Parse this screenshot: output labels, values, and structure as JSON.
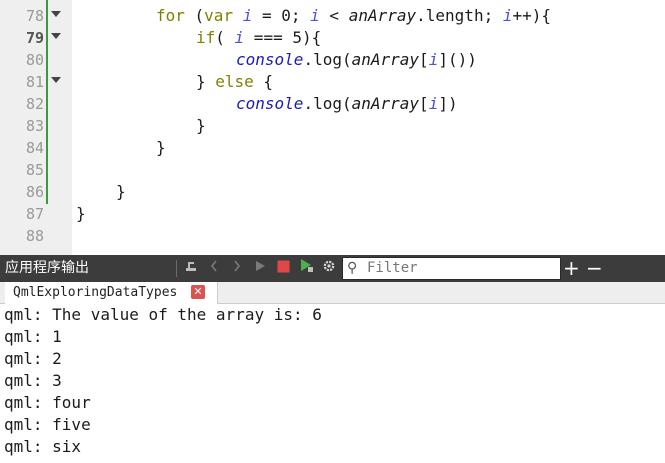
{
  "editor": {
    "gutter": [
      {
        "num": "78",
        "fold": true,
        "current": false
      },
      {
        "num": "79",
        "fold": true,
        "current": true
      },
      {
        "num": "80",
        "fold": false,
        "current": false
      },
      {
        "num": "81",
        "fold": true,
        "current": false
      },
      {
        "num": "82",
        "fold": false,
        "current": false
      },
      {
        "num": "83",
        "fold": false,
        "current": false
      },
      {
        "num": "84",
        "fold": false,
        "current": false
      },
      {
        "num": "85",
        "fold": false,
        "current": false
      },
      {
        "num": "86",
        "fold": false,
        "current": false
      },
      {
        "num": "87",
        "fold": false,
        "current": false
      },
      {
        "num": "88",
        "fold": false,
        "current": false
      }
    ],
    "code": {
      "l78": {
        "for": "for",
        "open": " (",
        "var": "var",
        "sp1": " ",
        "i1": "i",
        "eq": " = 0; ",
        "i2": "i",
        "lt": " < ",
        "arr": "anArray",
        "len": ".length; ",
        "i3": "i",
        "inc": "++){"
      },
      "l79": {
        "if": "if",
        "open": "( ",
        "i": "i",
        "rest": " === 5){"
      },
      "l80": {
        "console": "console",
        "log": ".log(",
        "arr": "anArray",
        "br": "[",
        "i": "i",
        "end": "]())"
      },
      "l81": {
        "close": "} ",
        "else": "else",
        "rest": " {"
      },
      "l82": {
        "console": "console",
        "log": ".log(",
        "arr": "anArray",
        "br": "[",
        "i": "i",
        "end": "])"
      },
      "l83": "}",
      "l84": "}",
      "l86": "}",
      "l87": "}"
    }
  },
  "output_pane": {
    "title": "应用程序输出",
    "filter_placeholder": "Filter",
    "search_glyph": "⚲",
    "plus": "+",
    "minus": "−",
    "tab_label": "QmlExploringDataTypes",
    "tab_close": "✕",
    "lines": [
      "qml: The value of the array is: 6",
      "qml: 1",
      "qml: 2",
      "qml: 3",
      "qml: four",
      "qml: five",
      "qml: six"
    ]
  },
  "colors": {
    "keyword": "#808000",
    "variable": "#5050d8",
    "object": "#1b1bb8",
    "stop_button": "#e04848",
    "run_debug": "#4caf50",
    "pane_bg": "#3c3c3c"
  }
}
